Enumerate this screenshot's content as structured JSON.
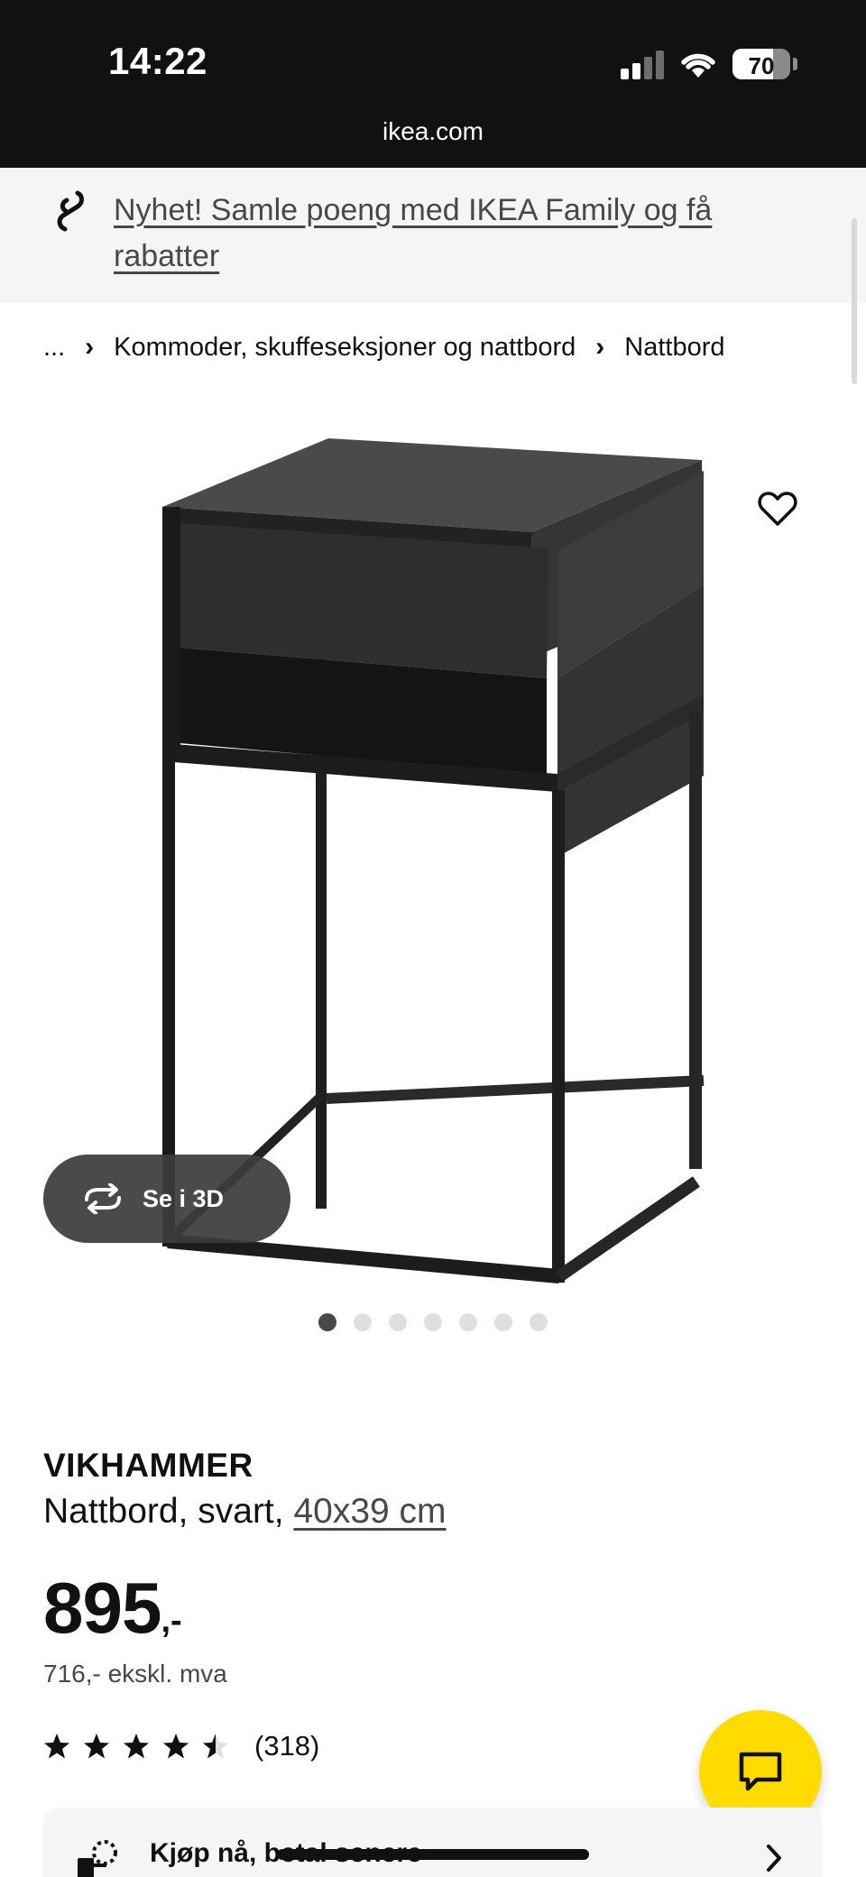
{
  "status_bar": {
    "time": "14:22",
    "battery": "70",
    "battery_level": 0.7,
    "url": "ikea.com"
  },
  "promo": {
    "link_text": "Nyhet! Samle poeng med IKEA Family og få rabatter"
  },
  "breadcrumb": {
    "ellipsis": "...",
    "items": [
      "Kommoder, skuffeseksjoner og nattbord",
      "Nattbord"
    ]
  },
  "gallery": {
    "view_3d_label": "Se i 3D",
    "image_count": 7,
    "active_index": 0
  },
  "product": {
    "name": "VIKHAMMER",
    "description": "Nattbord, svart,",
    "size_link": "40x39 cm",
    "price_int": "895",
    "price_suffix": ",-",
    "price_ex_vat": "716,- ekskl. mva",
    "rating_value": 4.5,
    "rating_max": 5,
    "review_count": "(318)"
  },
  "buy_now": {
    "label": "Kjøp nå, betal senere"
  },
  "colors": {
    "brand_yellow": "#ffdb00",
    "text": "#111111",
    "muted": "#484848"
  }
}
